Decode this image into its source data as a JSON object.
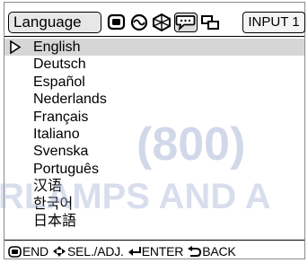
{
  "header": {
    "tab_label": "Language",
    "input_label": "INPUT 1",
    "icons": [
      "picture-icon",
      "sync-icon",
      "options-icon",
      "language-icon",
      "setup-icon"
    ],
    "selected_icon": "language-icon"
  },
  "languages": {
    "selected_index": 0,
    "items": [
      "English",
      "Deutsch",
      "Español",
      "Nederlands",
      "Français",
      "Italiano",
      "Svenska",
      "Português",
      "汉语",
      "한국어",
      "日本語"
    ]
  },
  "footer": {
    "end_label": "END",
    "sel_label": "SEL./ADJ.",
    "enter_label": "ENTER",
    "back_label": "BACK"
  },
  "watermark": {
    "line1": "(800)",
    "line2": "RLAMPS AND A",
    "color": "#9aa9cf"
  },
  "colors": {
    "selected_row": "#d6d6d6",
    "tab_bg": "#e7e7e7",
    "frame_border": "#8a8a8a"
  }
}
